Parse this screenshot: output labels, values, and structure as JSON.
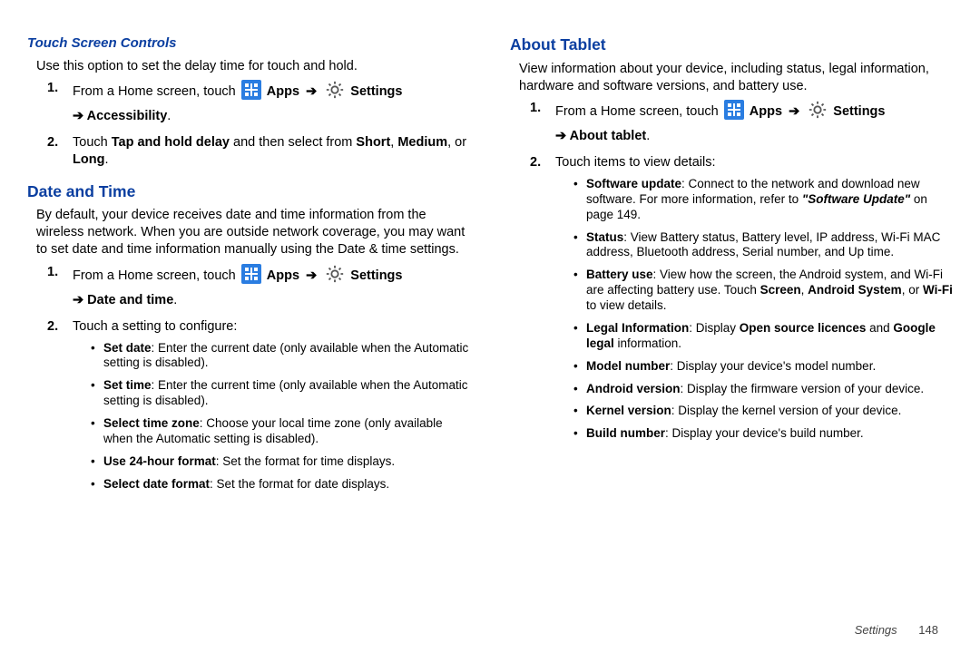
{
  "left": {
    "touchControls": {
      "heading": "Touch Screen Controls",
      "intro": "Use this option to set the delay time for touch and hold.",
      "step1_a": "From a Home screen, touch",
      "apps": "Apps",
      "arrow": "➔",
      "settings": "Settings",
      "step1_b": "➔ Accessibility",
      "step1_end": ".",
      "step2_a": "Touch ",
      "step2_bold1": "Tap and hold delay",
      "step2_mid": " and then select from ",
      "step2_bold2": "Short",
      "step2_comma": ", ",
      "step2_bold3": "Medium",
      "step2_or": ", or ",
      "step2_bold4": "Long",
      "step2_end": "."
    },
    "dateTime": {
      "heading": "Date and Time",
      "intro": "By default, your device receives date and time information from the wireless network. When you are outside network coverage, you may want to set date and time information manually using the Date & time settings.",
      "step1_a": "From a Home screen, touch",
      "apps": "Apps",
      "arrow": "➔",
      "settings": "Settings",
      "step1_b": "➔ Date and time",
      "step1_end": ".",
      "step2": "Touch a setting to configure:",
      "bullets": [
        {
          "b": "Set date",
          "t": ": Enter the current date (only available when the Automatic setting is disabled)."
        },
        {
          "b": "Set time",
          "t": ": Enter the current time (only available when the Automatic setting is disabled)."
        },
        {
          "b": "Select time zone",
          "t": ": Choose your local time zone (only available when the Automatic setting is disabled)."
        },
        {
          "b": "Use 24-hour format",
          "t": ": Set the format for time displays."
        },
        {
          "b": "Select date format",
          "t": ": Set the format for date displays."
        }
      ]
    }
  },
  "right": {
    "about": {
      "heading": "About Tablet",
      "intro": "View information about your device, including status, legal information, hardware and software versions, and battery use.",
      "step1_a": "From a Home screen, touch",
      "apps": "Apps",
      "arrow": "➔",
      "settings": "Settings",
      "step1_b": "➔ About tablet",
      "step1_end": ".",
      "step2": "Touch items to view details:",
      "b_su_label": "Software update",
      "b_su_text": ": Connect to the network and download new software. For more information, refer to ",
      "b_su_ref": "\"Software Update\"",
      "b_su_tail": "  on page 149.",
      "b_status_label": "Status",
      "b_status_text": ": View Battery status, Battery level, IP address, Wi-Fi MAC address, Bluetooth address, Serial number, and Up time.",
      "b_batt_label": "Battery use",
      "b_batt_text1": ": View how the screen, the Android system, and Wi-Fi are affecting battery use. Touch ",
      "b_batt_screen": "Screen",
      "b_batt_c1": ", ",
      "b_batt_android": "Android System",
      "b_batt_c2": ", or ",
      "b_batt_wifi": "Wi-Fi",
      "b_batt_text2": " to view details.",
      "b_legal_label": "Legal Information",
      "b_legal_text1": ": Display ",
      "b_legal_oss": "Open source licences",
      "b_legal_and": " and ",
      "b_legal_google": "Google legal",
      "b_legal_text2": " information.",
      "b_model_label": "Model number",
      "b_model_text": ": Display your device's model number.",
      "b_av_label": "Android version",
      "b_av_text": ": Display the firmware version of your device.",
      "b_kv_label": "Kernel version",
      "b_kv_text": ": Display the kernel version of your device.",
      "b_bn_label": "Build number",
      "b_bn_text": ": Display your device's build number."
    }
  },
  "footer": {
    "section": "Settings",
    "page": "148"
  }
}
